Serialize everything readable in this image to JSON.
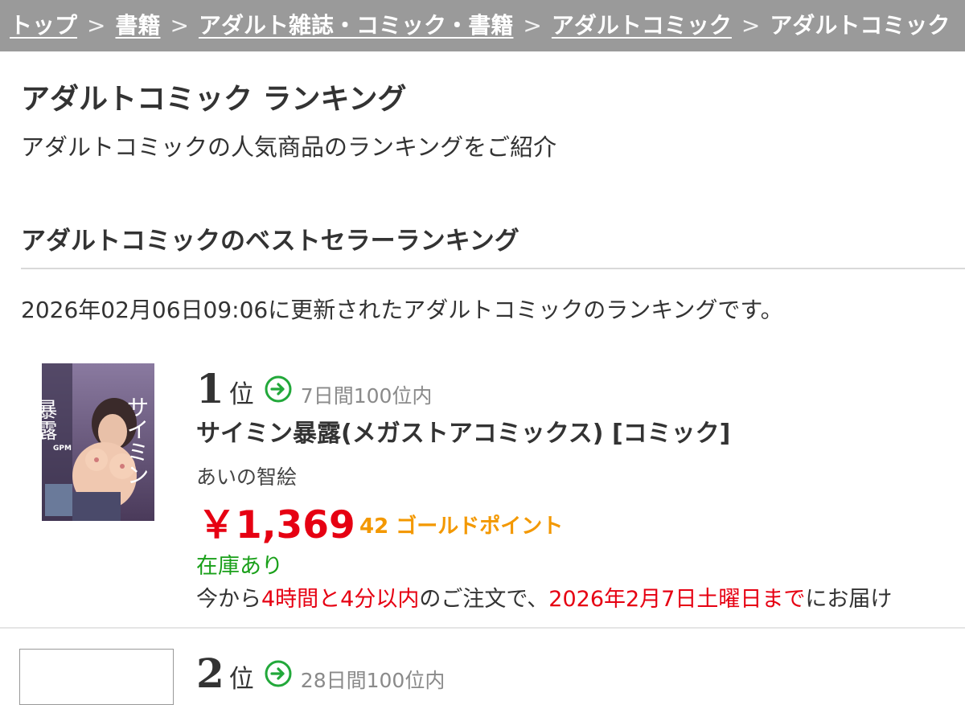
{
  "breadcrumb": {
    "items": [
      "トップ",
      "書籍",
      "アダルト雑誌・コミック・書籍",
      "アダルトコミック",
      "アダルトコミック"
    ],
    "separator": ">"
  },
  "page": {
    "title": "アダルトコミック ランキング",
    "description": "アダルトコミックの人気商品のランキングをご紹介"
  },
  "section": {
    "title": "アダルトコミックのベストセラーランキング",
    "updated_text": "2026年02月06日09:06に更新されたアダルトコミックのランキングです。"
  },
  "items": [
    {
      "rank": "1",
      "rank_suffix": "位",
      "rank_note": "7日間100位内",
      "title": "サイミン暴露(メガストアコミックス) [コミック]",
      "author": "あいの智絵",
      "price": "￥1,369",
      "points": "42 ゴールドポイント",
      "stock": "在庫あり",
      "delivery": {
        "prefix": "今から",
        "time": "4時間と4分以内",
        "middle": "のご注文で、",
        "date": "2026年2月7日土曜日まで",
        "suffix": "にお届け"
      },
      "cover_text": {
        "title_vertical": "サイミン",
        "title_kanji": "暴露",
        "label": "GPM"
      }
    },
    {
      "rank": "2",
      "rank_suffix": "位",
      "rank_note": "28日間100位内"
    }
  ],
  "colors": {
    "breadcrumb_bg": "#9a9a9a",
    "price": "#e60012",
    "points": "#f39800",
    "stock": "#1aa01a",
    "arrow": "#22a83a"
  }
}
